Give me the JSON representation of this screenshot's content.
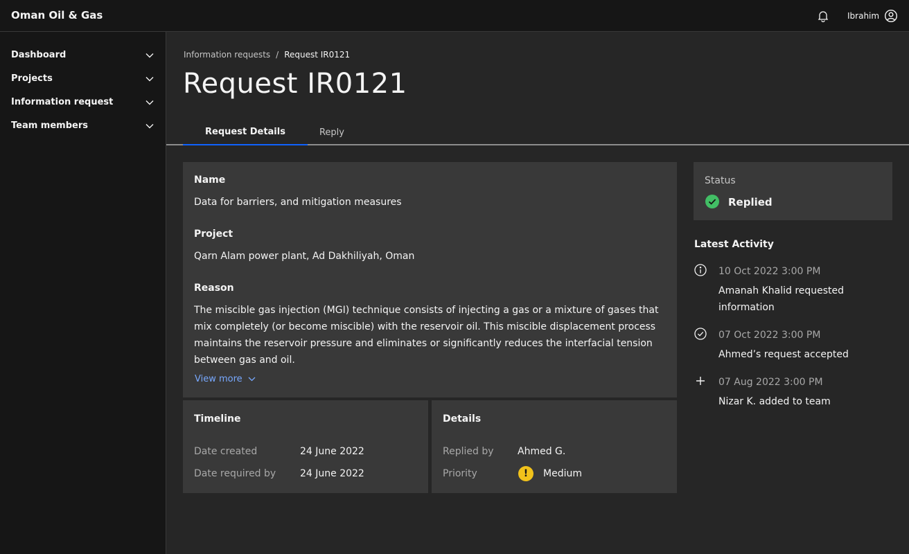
{
  "header": {
    "brand": "Oman Oil & Gas",
    "user_name": "Ibrahim",
    "icons": [
      "bell-icon",
      "user-avatar-icon"
    ]
  },
  "sidebar": {
    "items": [
      {
        "label": "Dashboard"
      },
      {
        "label": "Projects"
      },
      {
        "label": "Information request"
      },
      {
        "label": "Team members"
      }
    ]
  },
  "breadcrumb": {
    "parent": "Information requests",
    "separator": "/",
    "current": "Request IR0121"
  },
  "page": {
    "title": "Request IR0121"
  },
  "tabs": [
    {
      "label": "Request Details",
      "active": true
    },
    {
      "label": "Reply",
      "active": false
    }
  ],
  "main": {
    "name_label": "Name",
    "name_value": "Data for barriers, and mitigation measures",
    "project_label": "Project",
    "project_value": "Qarn Alam power plant, Ad Dakhiliyah, Oman",
    "reason_label": "Reason",
    "reason_value": "The miscible gas injection (MGI) technique consists of injecting a gas or a mixture of gases that mix completely (or become miscible) with the reservoir oil. This miscible displacement process maintains the reservoir pressure and eliminates or significantly reduces the interfacial tension between gas and oil.",
    "view_more": "View more"
  },
  "timeline": {
    "title": "Timeline",
    "date_created_label": "Date created",
    "date_created_value": "24 June 2022",
    "date_required_label": "Date required by",
    "date_required_value": "24 June 2022"
  },
  "details": {
    "title": "Details",
    "replied_by_label": "Replied by",
    "replied_by_value": "Ahmed G.",
    "priority_label": "Priority",
    "priority_value": "Medium",
    "priority_color": "#f1c21b"
  },
  "status": {
    "label": "Status",
    "value": "Replied",
    "color": "#42be65"
  },
  "activity": {
    "title": "Latest Activity",
    "items": [
      {
        "icon": "info-icon",
        "time": "10 Oct 2022 3:00 PM",
        "text": "Amanah Khalid requested information"
      },
      {
        "icon": "checkmark-outline-icon",
        "time": "07 Oct 2022 3:00 PM",
        "text": "Ahmed’s request accepted"
      },
      {
        "icon": "add-icon",
        "time": "07 Aug 2022 3:00 PM",
        "text": "Nizar K. added to team"
      }
    ]
  },
  "colors": {
    "accent": "#0f62fe",
    "link": "#78a9ff",
    "background": "#262626",
    "surface": "#393939",
    "header": "#161616"
  }
}
